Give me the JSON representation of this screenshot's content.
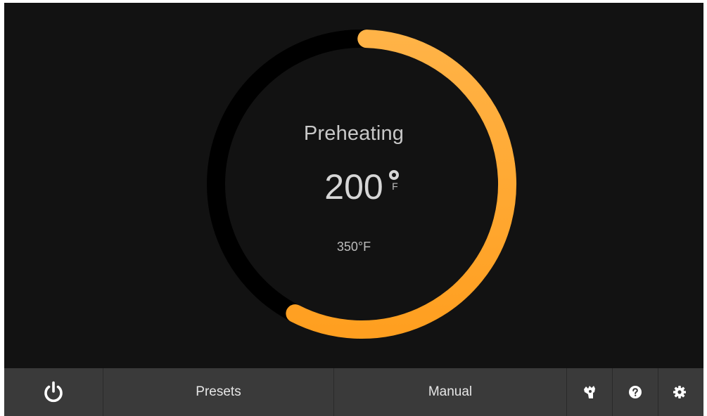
{
  "dial": {
    "status": "Preheating",
    "current_temp": "200",
    "current_unit": "F",
    "target_temp": "350°F",
    "progress_fraction": 0.57,
    "accent_color": "#FFA733",
    "track_color": "#000000"
  },
  "bottom_bar": {
    "power_icon": "power-icon",
    "presets_label": "Presets",
    "manual_label": "Manual",
    "gesture_icon": "hand-gesture-icon",
    "help_icon": "help-icon",
    "settings_icon": "gear-icon"
  }
}
